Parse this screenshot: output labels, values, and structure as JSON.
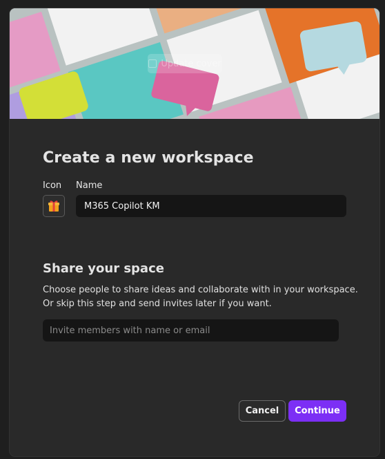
{
  "cover": {
    "update_label": "Update cover"
  },
  "workspace": {
    "title": "Create a new workspace",
    "icon_label": "Icon",
    "name_label": "Name",
    "name_value": "M365 Copilot KM",
    "icon": "gift-icon"
  },
  "share": {
    "title": "Share your space",
    "description_line1": "Choose people to share ideas and collaborate with in your workspace.",
    "description_line2": "Or skip this step and send invites later if you want.",
    "invite_placeholder": "Invite members with name or email"
  },
  "actions": {
    "cancel_label": "Cancel",
    "continue_label": "Continue",
    "accent_color": "#7c2ff5"
  }
}
